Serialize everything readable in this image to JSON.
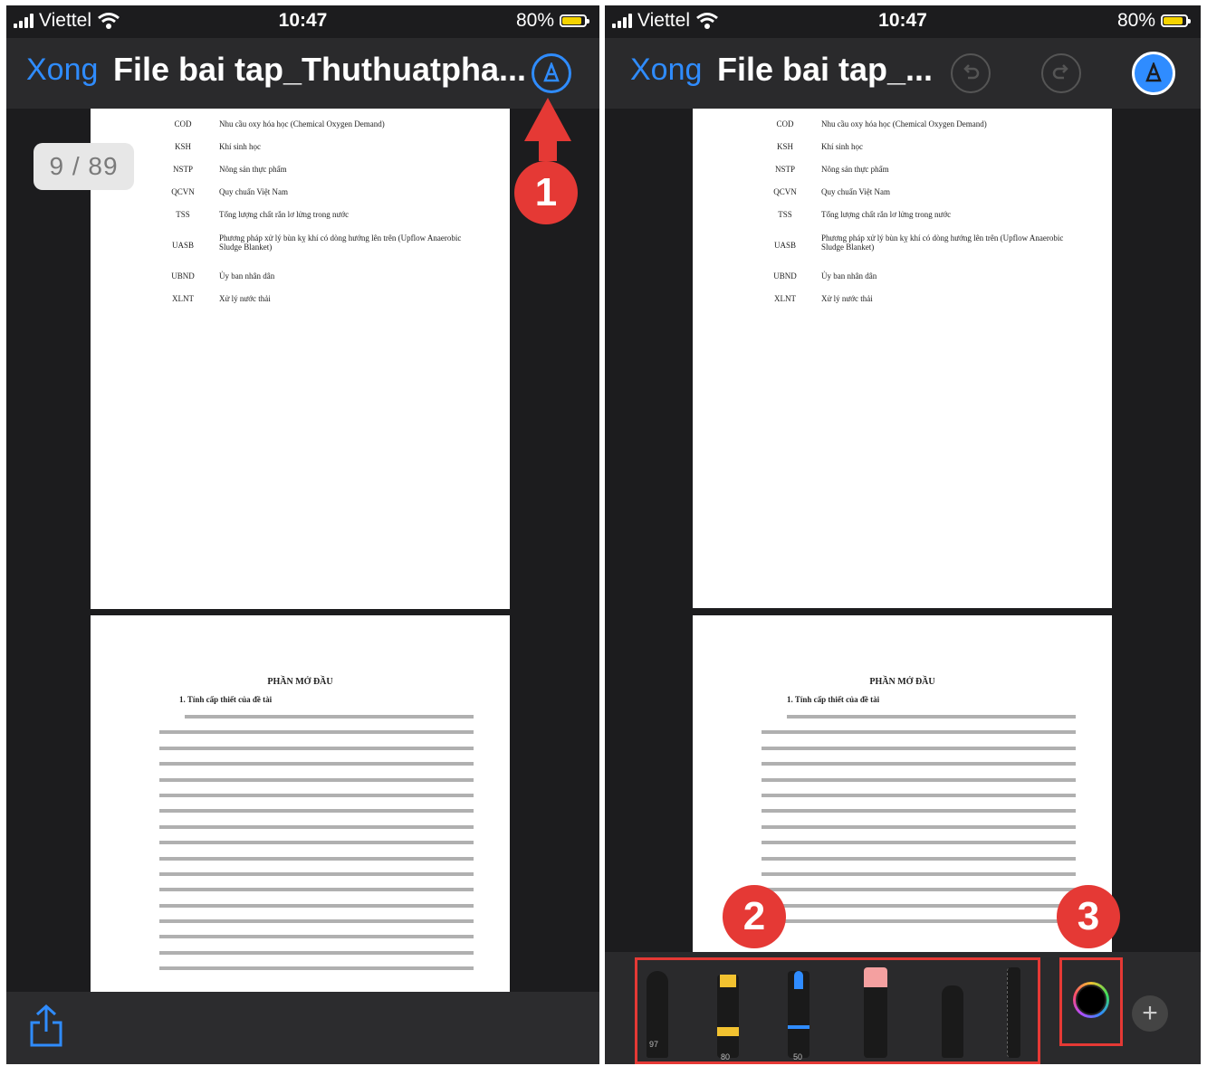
{
  "left": {
    "status": {
      "carrier": "Viettel",
      "time": "10:47",
      "battery": "80%"
    },
    "nav": {
      "done_label": "Xong",
      "title": "File bai tap_Thuthuatpha..."
    },
    "page_counter": "9 / 89",
    "callout": "1"
  },
  "right": {
    "status": {
      "carrier": "Viettel",
      "time": "10:47",
      "battery": "80%"
    },
    "nav": {
      "done_label": "Xong",
      "title": "File bai tap_..."
    },
    "callouts": [
      "2",
      "3"
    ],
    "tool_labels": {
      "pen": "97",
      "marker": "80",
      "pencil": "50"
    }
  },
  "document": {
    "abbreviations": [
      {
        "abbr": "COD",
        "desc": "Nhu cầu oxy hóa học (Chemical Oxygen Demand)"
      },
      {
        "abbr": "KSH",
        "desc": "Khí sinh học"
      },
      {
        "abbr": "NSTP",
        "desc": "Nông sản thực phẩm"
      },
      {
        "abbr": "QCVN",
        "desc": "Quy chuẩn Việt Nam"
      },
      {
        "abbr": "TSS",
        "desc": "Tổng lượng chất rắn lơ lửng trong nước"
      },
      {
        "abbr": "UASB",
        "desc": "Phương pháp xử lý bùn kỵ khí có dòng hướng lên trên (Upflow Anaerobic Sludge Blanket)"
      },
      {
        "abbr": "UBND",
        "desc": "Ủy ban nhân dân"
      },
      {
        "abbr": "XLNT",
        "desc": "Xử lý nước thải"
      }
    ],
    "heading": "PHẦN MỞ ĐẦU",
    "subheading": "1. Tính cấp thiết của đề tài"
  },
  "colors": {
    "accent": "#2f8cff",
    "callout": "#e53935",
    "background": "#1c1c1e"
  }
}
